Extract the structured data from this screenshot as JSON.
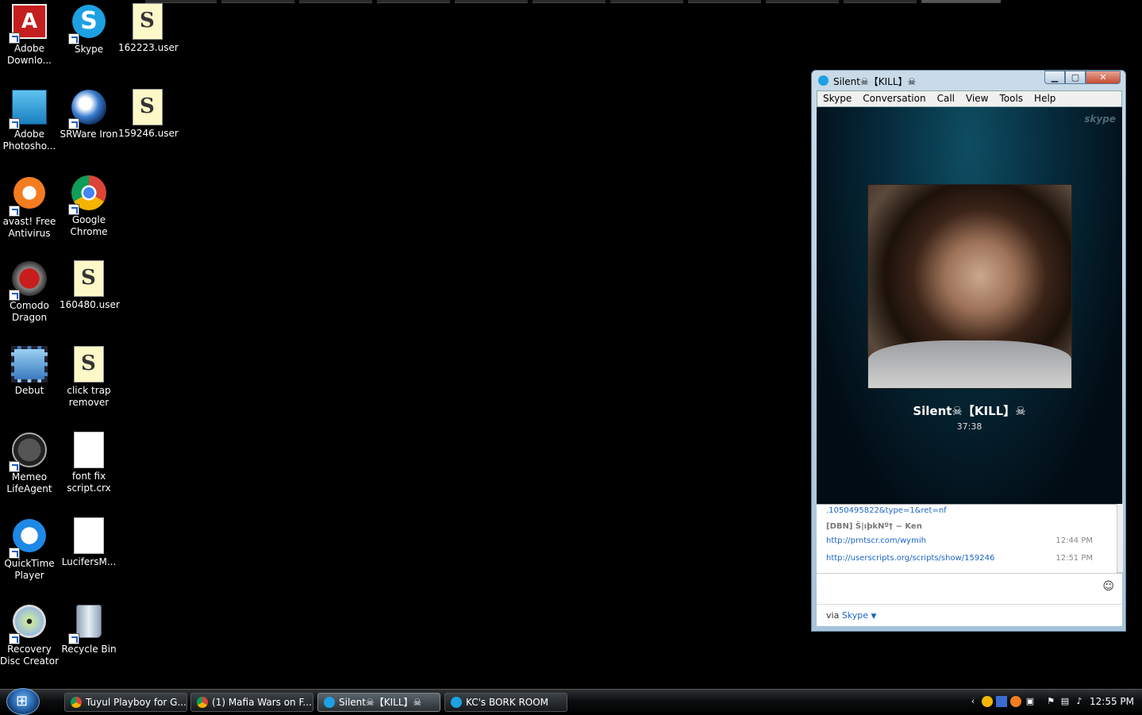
{
  "desktop": {
    "icons": [
      {
        "label": "Adobe Downlo..."
      },
      {
        "label": "Adobe Photosho..."
      },
      {
        "label": "avast! Free Antivirus"
      },
      {
        "label": "Comodo Dragon"
      },
      {
        "label": "Debut"
      },
      {
        "label": "Memeo LifeAgent"
      },
      {
        "label": "QuickTime Player"
      },
      {
        "label": "Recovery Disc Creator"
      },
      {
        "label": "Skype"
      },
      {
        "label": "SRWare Iron"
      },
      {
        "label": "Google Chrome"
      },
      {
        "label": "160480.user"
      },
      {
        "label": "click trap remover"
      },
      {
        "label": "font fix script.crx"
      },
      {
        "label": "LucifersM..."
      },
      {
        "label": "Recycle Bin"
      },
      {
        "label": "162223.user"
      },
      {
        "label": "159246.user"
      }
    ]
  },
  "skype_window": {
    "title": "Silent☠【KILL】☠",
    "menu": [
      "Skype",
      "Conversation",
      "Call",
      "View",
      "Tools",
      "Help"
    ],
    "watermark": "skype",
    "caller_name": "Silent☠【KILL】☠",
    "call_duration": "37:38",
    "chat": {
      "partial_line": ".1050495822&type=1&ret=nf",
      "sender": "[DBN] Š|ıþkNº† ~ Ken",
      "messages": [
        {
          "text": "http://prntscr.com/wymih",
          "time": "12:44 PM"
        },
        {
          "text": "http://userscripts.org/scripts/show/159246",
          "time": "12:51 PM"
        }
      ]
    },
    "via_prefix": "via",
    "via_link": "Skype"
  },
  "taskbar": {
    "buttons": [
      {
        "label": "Tuyul Playboy for G..."
      },
      {
        "label": "(1) Mafia Wars on F..."
      },
      {
        "label": "Silent☠【KILL】☠"
      },
      {
        "label": "KC's BORK ROOM"
      }
    ],
    "clock": "12:55 PM"
  }
}
